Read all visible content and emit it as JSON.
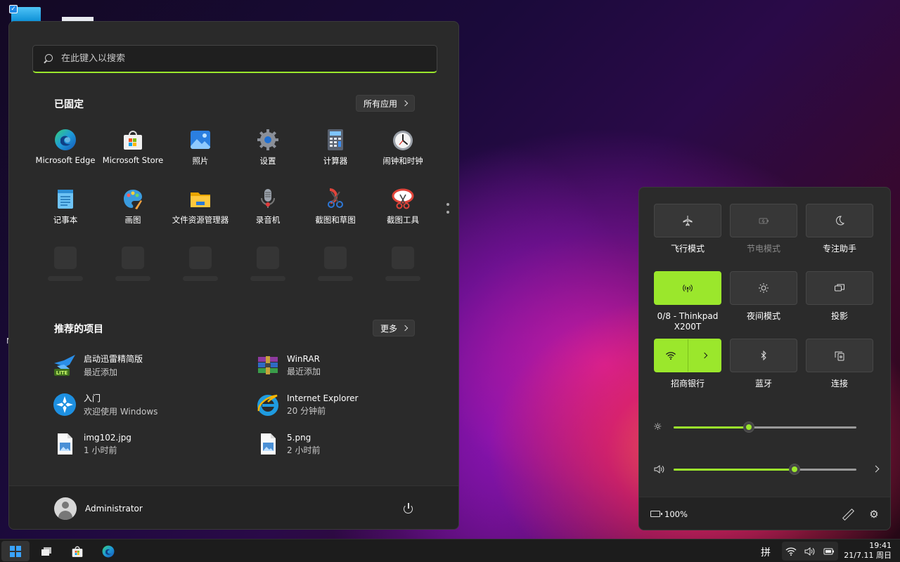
{
  "search": {
    "placeholder": "在此键入以搜索"
  },
  "pinned": {
    "title": "已固定",
    "all_apps_label": "所有应用",
    "apps": [
      {
        "label": "Microsoft Edge",
        "icon": "edge-icon"
      },
      {
        "label": "Microsoft Store",
        "icon": "store-icon"
      },
      {
        "label": "照片",
        "icon": "photos-icon"
      },
      {
        "label": "设置",
        "icon": "settings-icon"
      },
      {
        "label": "计算器",
        "icon": "calculator-icon"
      },
      {
        "label": "闹钟和时钟",
        "icon": "clock-icon"
      },
      {
        "label": "记事本",
        "icon": "notepad-icon"
      },
      {
        "label": "画图",
        "icon": "paint-icon"
      },
      {
        "label": "文件资源管理器",
        "icon": "folder-icon"
      },
      {
        "label": "录音机",
        "icon": "recorder-icon"
      },
      {
        "label": "截图和草图",
        "icon": "snip-sketch-icon"
      },
      {
        "label": "截图工具",
        "icon": "snipping-tool-icon"
      }
    ]
  },
  "recommended": {
    "title": "推荐的项目",
    "more_label": "更多",
    "items": [
      {
        "name": "启动迅雷精简版",
        "sub": "最近添加",
        "icon": "thunder-lite-icon"
      },
      {
        "name": "WinRAR",
        "sub": "最近添加",
        "icon": "winrar-icon"
      },
      {
        "name": "入门",
        "sub": "欢迎使用 Windows",
        "icon": "get-started-icon"
      },
      {
        "name": "Internet Explorer",
        "sub": "20 分钟前",
        "icon": "ie-icon"
      },
      {
        "name": "img102.jpg",
        "sub": "1 小时前",
        "icon": "image-file-icon"
      },
      {
        "name": "5.png",
        "sub": "2 小时前",
        "icon": "image-file-icon"
      }
    ]
  },
  "user": {
    "name": "Administrator"
  },
  "quick_settings": {
    "tiles": [
      {
        "label": "飞行模式",
        "icon": "airplane-icon",
        "on": false,
        "disabled": false
      },
      {
        "label": "节电模式",
        "icon": "battery-saver-icon",
        "on": false,
        "disabled": true
      },
      {
        "label": "专注助手",
        "icon": "moon-icon",
        "on": false,
        "disabled": false
      },
      {
        "label": "0/8 - Thinkpad X200T",
        "icon": "hotspot-icon",
        "on": true,
        "disabled": false
      },
      {
        "label": "夜间模式",
        "icon": "night-light-icon",
        "on": false,
        "disabled": false
      },
      {
        "label": "投影",
        "icon": "project-icon",
        "on": false,
        "disabled": false
      },
      {
        "label": "招商银行",
        "icon": "wifi-icon",
        "on": true,
        "disabled": false
      },
      {
        "label": "蓝牙",
        "icon": "bluetooth-icon",
        "on": false,
        "disabled": false
      },
      {
        "label": "连接",
        "icon": "cast-icon",
        "on": false,
        "disabled": false
      }
    ],
    "brightness": 0.41,
    "volume": 0.66,
    "battery": "100%"
  },
  "taskbar": {
    "ime": "拼",
    "time": "19:41",
    "date": "21/7.11 周日"
  },
  "colors": {
    "accent": "#9be72c",
    "windows_blue": "#3aa3ff"
  }
}
